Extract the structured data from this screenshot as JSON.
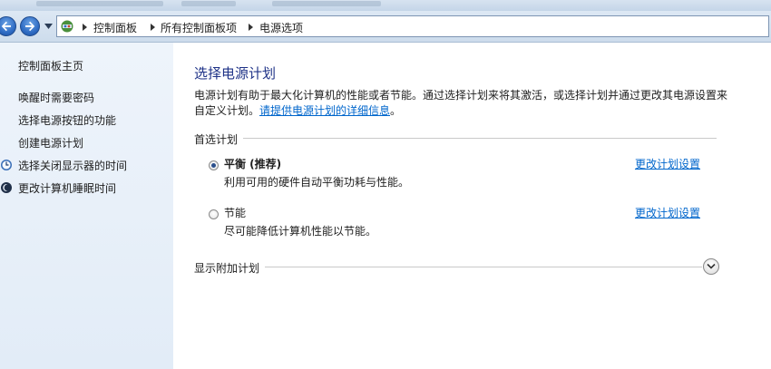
{
  "breadcrumb": {
    "items": [
      "控制面板",
      "所有控制面板项",
      "电源选项"
    ]
  },
  "sidebar": {
    "home_label": "控制面板主页",
    "items": [
      {
        "label": "唤醒时需要密码",
        "icon": "none"
      },
      {
        "label": "选择电源按钮的功能",
        "icon": "none"
      },
      {
        "label": "创建电源计划",
        "icon": "none"
      },
      {
        "label": "选择关闭显示器的时间",
        "icon": "monitor-clock-icon"
      },
      {
        "label": "更改计算机睡眠时间",
        "icon": "moon-icon"
      }
    ]
  },
  "main": {
    "title": "选择电源计划",
    "description": "电源计划有助于最大化计算机的性能或者节能。通过选择计划来将其激活，或选择计划并通过更改其电源设置来自定义计划。",
    "details_link": "请提供电源计划的详细信息",
    "description_end": "。",
    "preferred_section": "首选计划",
    "plans": [
      {
        "name": "平衡 (推荐)",
        "description": "利用可用的硬件自动平衡功耗与性能。",
        "link": "更改计划设置",
        "selected": true
      },
      {
        "name": "节能",
        "description": "尽可能降低计算机性能以节能。",
        "link": "更改计划设置",
        "selected": false
      }
    ],
    "additional_section": "显示附加计划"
  },
  "colors": {
    "title": "#1e3287",
    "link": "#0066cc",
    "sidebar_bg": "#e8f0f9"
  }
}
